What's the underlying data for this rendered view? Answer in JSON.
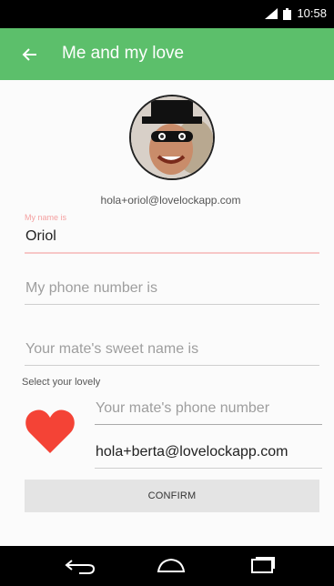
{
  "status_bar": {
    "time": "10:58"
  },
  "app_bar": {
    "title": "Me and my love",
    "back_icon": "arrow-left-icon"
  },
  "profile": {
    "email": "hola+oriol@lovelockapp.com"
  },
  "form": {
    "name_label": "My name is",
    "name_value": "Oriol",
    "phone_placeholder": "My phone number is",
    "mate_name_placeholder": "Your mate's sweet name is",
    "select_label": "Select your lovely",
    "mate_phone_placeholder": "Your mate's phone number",
    "mate_email_value": "hola+berta@lovelockapp.com",
    "confirm_label": "CONFIRM"
  },
  "colors": {
    "app_bar": "#5cbf6b",
    "heart": "#f44336",
    "name_label": "#f4a0a0"
  }
}
